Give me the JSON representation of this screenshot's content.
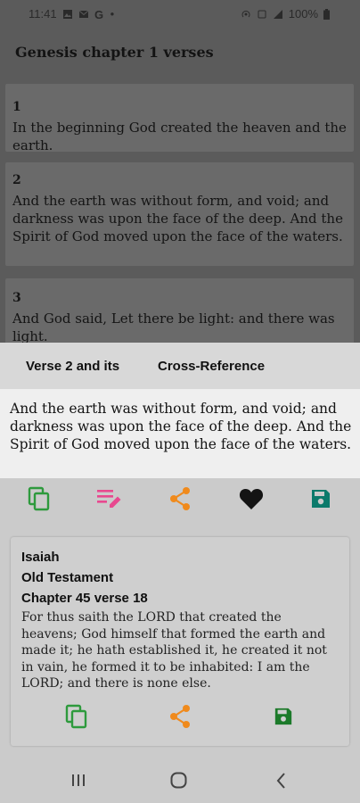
{
  "status": {
    "time": "11:41",
    "battery": "100%"
  },
  "header": {
    "title": "Genesis chapter 1 verses"
  },
  "verses": [
    {
      "number": "1",
      "text": "In the beginning God created the heaven and the earth."
    },
    {
      "number": "2",
      "text": "And the earth was without form, and void; and darkness was upon the face of the deep. And the Spirit of God moved upon the face of the waters."
    },
    {
      "number": "3",
      "text": "And God said, Let there be light: and there was light."
    }
  ],
  "sheet": {
    "tabs": [
      "Verse 2 and its",
      "Cross-Reference"
    ],
    "selected_verse_text": "And the earth was without form, and void; and darkness was upon the face of the deep. And the Spirit of God moved upon the face of the waters.",
    "actions": [
      "copy-icon",
      "edit-note-icon",
      "share-icon",
      "heart-icon",
      "save-icon"
    ],
    "colors": {
      "copy": "#2e9a3d",
      "edit": "#e8498f",
      "share": "#f08a1c",
      "heart": "#141414",
      "save": "#0c7a6b",
      "save_small": "#1c7a2a"
    }
  },
  "reference": {
    "book": "Isaiah",
    "testament": "Old Testament",
    "location": "Chapter 45 verse 18",
    "text": "For thus saith the LORD that created the heavens; God himself that formed the earth and made it; he hath established it, he created it not in vain, he formed it to be inhabited: I am the LORD; and there is none else."
  },
  "nav": {
    "buttons": [
      "recent-apps-icon",
      "home-icon",
      "back-icon"
    ]
  }
}
